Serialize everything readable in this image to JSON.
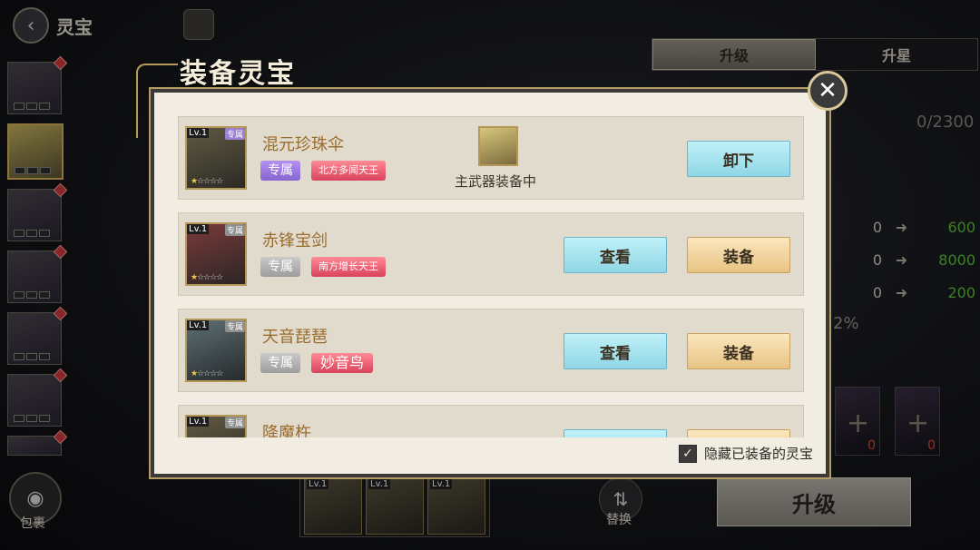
{
  "header": {
    "title": "灵宝"
  },
  "tabs": [
    {
      "label": "升级",
      "active": true
    },
    {
      "label": "升星",
      "active": false
    }
  ],
  "right_panel": {
    "exp": "0/2300",
    "stats": [
      {
        "current": "0",
        "next": "600"
      },
      {
        "current": "0",
        "next": "8000"
      },
      {
        "current": "0",
        "next": "200"
      }
    ],
    "percent": "2%",
    "slots": [
      {
        "count": "0"
      },
      {
        "count": "0"
      }
    ]
  },
  "bottom": {
    "gems": [
      {
        "level": "Lv.1"
      },
      {
        "level": "Lv.1"
      },
      {
        "level": "Lv.1"
      }
    ],
    "swap_label": "替换",
    "upgrade_label": "升级",
    "bag_label": "包裹"
  },
  "dialog": {
    "title": "装备灵宝",
    "items": [
      {
        "level": "Lv.1",
        "tag": "专属",
        "name": "混元珍珠伞",
        "exclusive": "专属",
        "owner": "北方多闻天王",
        "equipped_label": "主武器装备中",
        "unequip_label": "卸下",
        "star_filled": "★"
      },
      {
        "level": "Lv.1",
        "tag": "专属",
        "name": "赤锋宝剑",
        "exclusive": "专属",
        "owner": "南方增长天王",
        "view_label": "查看",
        "equip_label": "装备",
        "star_filled": "★"
      },
      {
        "level": "Lv.1",
        "tag": "专属",
        "name": "天音琵琶",
        "exclusive": "专属",
        "owner": "妙音鸟",
        "view_label": "查看",
        "equip_label": "装备",
        "star_filled": "★"
      },
      {
        "level": "Lv.1",
        "tag": "专属",
        "name": "降魔杵"
      }
    ],
    "hide_equipped_label": "隐藏已装备的灵宝",
    "hide_equipped_checked": true
  },
  "icons": {
    "back": "back-arrow-icon",
    "close": "close-icon",
    "arrow": "right-arrow-icon",
    "plus": "plus-icon",
    "check": "check-icon",
    "star": "star-icon"
  }
}
